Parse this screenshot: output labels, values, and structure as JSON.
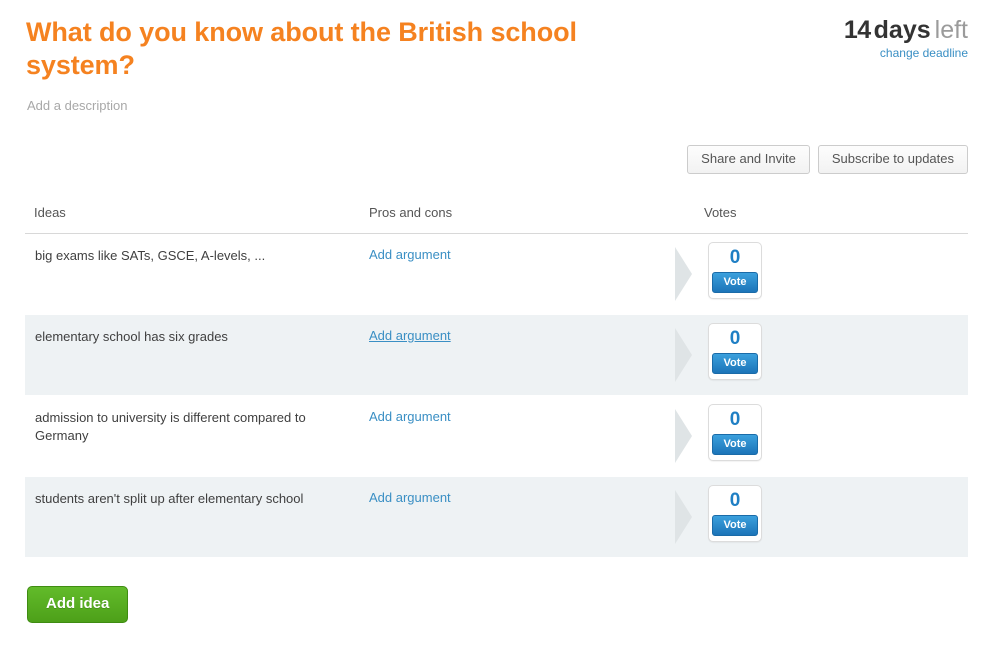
{
  "header": {
    "title": "What do you know about the British school system?",
    "description_placeholder": "Add a description",
    "deadline": {
      "number": "14",
      "unit": "days",
      "suffix": "left",
      "change_link": "change deadline"
    }
  },
  "toolbar": {
    "share_label": "Share and Invite",
    "subscribe_label": "Subscribe to updates"
  },
  "table": {
    "columns": {
      "ideas": "Ideas",
      "pros_and_cons": "Pros and cons",
      "votes": "Votes"
    },
    "rows": [
      {
        "idea": "big exams like SATs, GSCE, A-levels, ...",
        "add_argument": "Add argument",
        "votes": "0",
        "vote_label": "Vote"
      },
      {
        "idea": "elementary school has six grades",
        "add_argument": "Add argument",
        "votes": "0",
        "vote_label": "Vote"
      },
      {
        "idea": "admission to university is different compared to Germany",
        "add_argument": "Add argument",
        "votes": "0",
        "vote_label": "Vote"
      },
      {
        "idea": "students aren't split up after elementary school",
        "add_argument": "Add argument",
        "votes": "0",
        "vote_label": "Vote"
      }
    ]
  },
  "footer": {
    "add_idea_label": "Add idea"
  },
  "colors": {
    "title_orange": "#f58220",
    "link_blue": "#3a8fc4",
    "vote_blue": "#1f7fc4",
    "add_idea_green": "#4da019",
    "alt_row_bg": "#eef2f4"
  }
}
